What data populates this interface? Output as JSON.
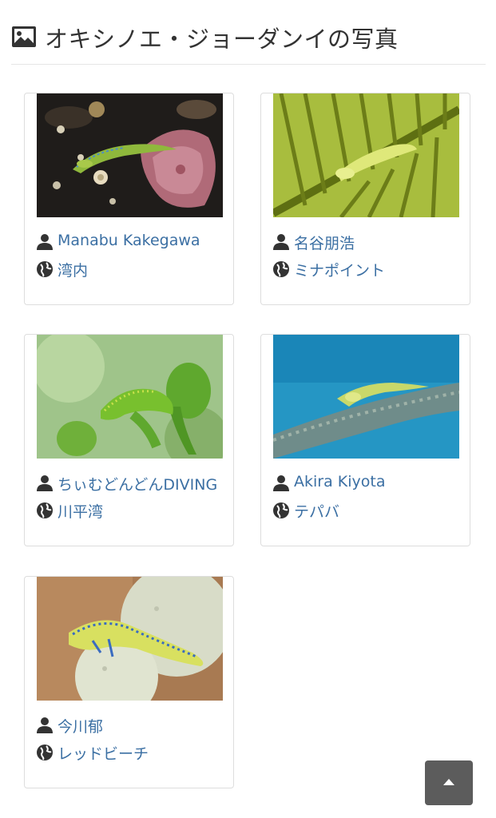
{
  "page": {
    "title": "オキシノエ・ジョーダンイの写真"
  },
  "photos": [
    {
      "photographer": "Manabu Kakegawa",
      "location": "湾内"
    },
    {
      "photographer": "名谷朋浩",
      "location": "ミナポイント"
    },
    {
      "photographer": "ちぃむどんどんDIVING",
      "location": "川平湾"
    },
    {
      "photographer": "Akira Kiyota",
      "location": "テパバ"
    },
    {
      "photographer": "今川郁",
      "location": "レッドビーチ"
    }
  ],
  "icons": {
    "header": "picture-icon",
    "photographer": "user-icon",
    "location": "globe-icon",
    "back_to_top": "arrow-up-icon"
  },
  "colors": {
    "link": "#3b6fa3",
    "title": "#333333",
    "button": "#5c5c5c"
  }
}
